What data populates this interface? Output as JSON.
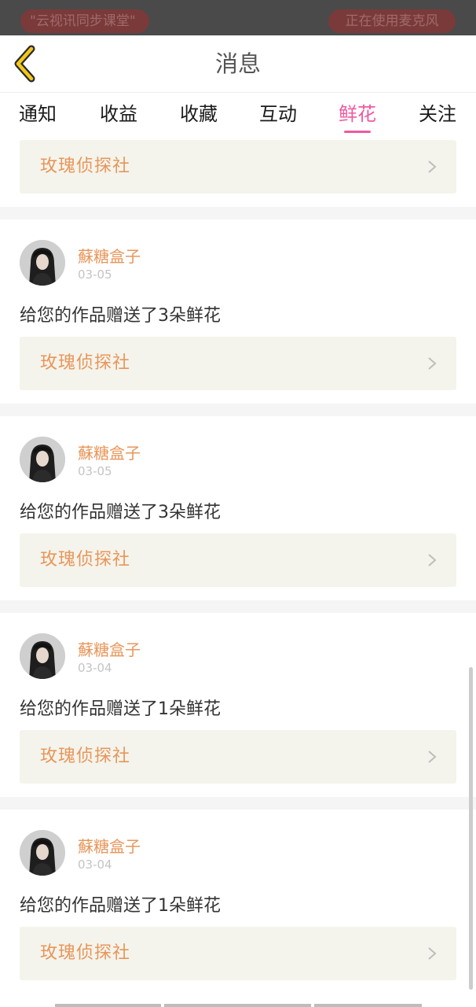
{
  "status_bar": {
    "left_pill": "\"云视讯同步课堂\"",
    "right_pill": "正在使用麦克风"
  },
  "header": {
    "title": "消息",
    "back_icon": "chevron-left-icon"
  },
  "tabs": [
    {
      "label": "通知",
      "active": false
    },
    {
      "label": "收益",
      "active": false
    },
    {
      "label": "收藏",
      "active": false
    },
    {
      "label": "互动",
      "active": false
    },
    {
      "label": "鲜花",
      "active": true
    },
    {
      "label": "关注",
      "active": false
    }
  ],
  "top_card": {
    "link_title": "玫瑰侦探社"
  },
  "feed_items": [
    {
      "user": "蘇糖盒子",
      "time": "03-05",
      "message": "给您的作品赠送了3朵鲜花",
      "link_title": "玫瑰侦探社"
    },
    {
      "user": "蘇糖盒子",
      "time": "03-05",
      "message": "给您的作品赠送了3朵鲜花",
      "link_title": "玫瑰侦探社"
    },
    {
      "user": "蘇糖盒子",
      "time": "03-04",
      "message": "给您的作品赠送了1朵鲜花",
      "link_title": "玫瑰侦探社"
    },
    {
      "user": "蘇糖盒子",
      "time": "03-04",
      "message": "给您的作品赠送了1朵鲜花",
      "link_title": "玫瑰侦探社"
    }
  ],
  "colors": {
    "accent_pink": "#ee5aa0",
    "username_orange": "#e8965a",
    "back_arrow_yellow": "#f2c81c",
    "card_bg": "#f4f4ec"
  }
}
